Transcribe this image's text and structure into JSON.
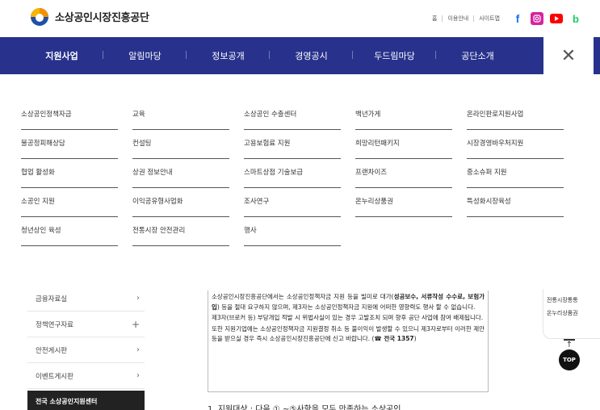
{
  "header": {
    "org_name": "소상공인시장진흥공단",
    "util_links": [
      "홈",
      "이용안내",
      "사이트맵"
    ],
    "sns": [
      "facebook-icon",
      "instagram-icon",
      "youtube-icon",
      "blog-icon"
    ]
  },
  "nav": {
    "items": [
      "지원사업",
      "알림마당",
      "정보공개",
      "경영공시",
      "두드림마당",
      "공단소개"
    ],
    "active": "지원사업",
    "close_symbol": "✕"
  },
  "mega_menu": {
    "rows": [
      [
        "소상공인정책자금",
        "교육",
        "소상공인 수출센터",
        "백년가게",
        "온라인판로지원사업"
      ],
      [
        "불공정피해상담",
        "컨설팅",
        "고용보험료 지원",
        "희망리턴패키지",
        "시장경영바우처지원"
      ],
      [
        "협업 활성화",
        "상권 정보안내",
        "스마트상점 기술보급",
        "프랜차이즈",
        "중소슈퍼 지원"
      ],
      [
        "소공인 지원",
        "이익공유형사업화",
        "조사연구",
        "온누리상품권",
        "특성화시장육성"
      ],
      [
        "청년상인 육성",
        "전통시장 안전관리",
        "행사",
        "",
        ""
      ]
    ]
  },
  "sidebar": {
    "items": [
      {
        "label": "금융자료실",
        "indicator": "›"
      },
      {
        "label": "정책연구자료",
        "indicator": "+"
      },
      {
        "label": "안전게시판",
        "indicator": "›"
      },
      {
        "label": "이벤트게시판",
        "indicator": "›"
      }
    ],
    "highlight": "전국 소상공인지원센터"
  },
  "notice": {
    "p1_a": "소상공인시장진흥공단에서는 소상공인정책자금 지원 등을 빌미로 대가(",
    "p1_b": "성공보수, 서류작성 수수료, 보험가입",
    "p1_c": ") 등을 절대 요구하지 않으며, 제3자는 소상공인정책자금 지원에 어떠한 영향력도 행사 할 수 없습니다.",
    "p2": "제3자(브로커 등) 부당개입 적발 시 위법사실이 있는 경우 고발조치 되며 향후 공단 사업에 참여 배제됩니다.",
    "p3_a": "또한 지원기업에는 소상공인정책자금 지원결정 취소 등 불이익이 발생할 수 있으니 제3자로부터 이러한 제안 등을 받으실 경우 즉시 소상공인시장진흥공단에 신고 바랍니다. (",
    "p3_b": "☎ 전국 1357",
    "p3_c": ")",
    "following": "1. 지원대상 : 다음 ① ~⑤사항을 모두 만족하는 소상공인"
  },
  "quick": {
    "links": [
      "전통시장통통",
      "온누리상품권"
    ],
    "top_label": "TOP",
    "top_arrow": "↑"
  }
}
